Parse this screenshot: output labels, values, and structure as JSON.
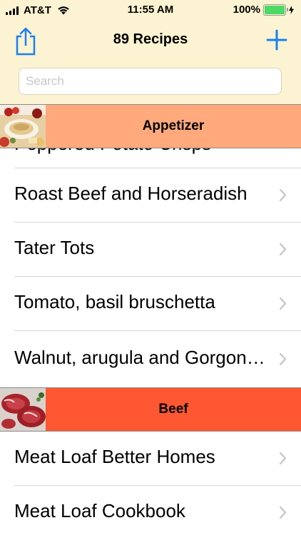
{
  "status_bar": {
    "carrier": "AT&T",
    "time": "11:55 AM",
    "battery_percent": "100%",
    "battery_level": 1.0,
    "battery_color": "#4cd964"
  },
  "nav": {
    "title": "89 Recipes",
    "share_icon": "share-icon",
    "add_icon": "plus-icon",
    "tint_color": "#1a7ff5",
    "background": "#fbf3d1"
  },
  "search": {
    "placeholder": "Search",
    "value": ""
  },
  "sections": [
    {
      "title": "Appetizer",
      "color": "#ffa97c",
      "thumb": "appetizer-photo",
      "partial_item": "Peppered Potato Crisps",
      "items": [
        "Roast Beef and Horseradish",
        "Tater Tots",
        "Tomato, basil bruschetta",
        "Walnut, arugula and Gorgonzola"
      ]
    },
    {
      "title": "Beef",
      "color": "#ff5731",
      "thumb": "beef-photo",
      "items": [
        "Meat Loaf Better Homes",
        "Meat Loaf Cookbook"
      ]
    }
  ]
}
